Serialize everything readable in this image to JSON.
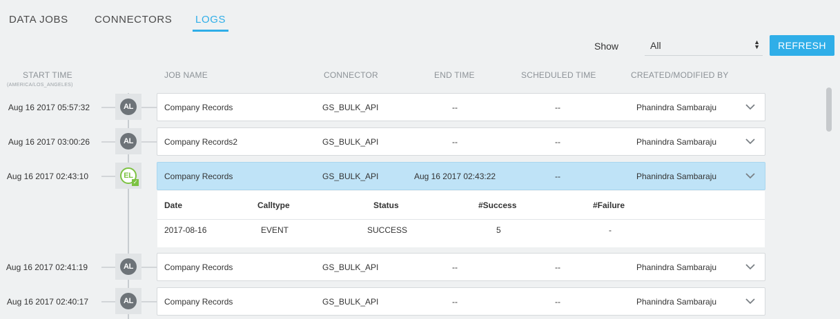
{
  "tabs": [
    {
      "label": "DATA JOBS",
      "active": false
    },
    {
      "label": "CONNECTORS",
      "active": false
    },
    {
      "label": "LOGS",
      "active": true
    }
  ],
  "filter": {
    "show_label": "Show",
    "selected": "All",
    "refresh_label": "REFRESH"
  },
  "columns": {
    "start_time": "START TIME",
    "start_time_tz": "(AMERICA/LOS_ANGELES)",
    "job_name": "JOB NAME",
    "connector": "CONNECTOR",
    "end_time": "END TIME",
    "scheduled_time": "SCHEDULED TIME",
    "created_by": "CREATED/MODIFIED BY"
  },
  "jobs": [
    {
      "start": "Aug 16 2017 05:57:32",
      "badge": "AL",
      "name": "Company Records",
      "connector": "GS_BULK_API",
      "end": "--",
      "scheduled": "--",
      "by": "Phanindra Sambaraju"
    },
    {
      "start": "Aug 16 2017 03:00:26",
      "badge": "AL",
      "name": "Company Records2",
      "connector": "GS_BULK_API",
      "end": "--",
      "scheduled": "--",
      "by": "Phanindra Sambaraju"
    },
    {
      "start": "Aug 16 2017 02:43:10",
      "badge": "EL",
      "name": "Company Records",
      "connector": "GS_BULK_API",
      "end": "Aug 16 2017 02:43:22",
      "scheduled": "--",
      "by": "Phanindra Sambaraju"
    },
    {
      "start": "Aug 16 2017 02:41:19",
      "badge": "AL",
      "name": "Company Records",
      "connector": "GS_BULK_API",
      "end": "--",
      "scheduled": "--",
      "by": "Phanindra Sambaraju"
    },
    {
      "start": "Aug 16 2017 02:40:17",
      "badge": "AL",
      "name": "Company Records",
      "connector": "GS_BULK_API",
      "end": "--",
      "scheduled": "--",
      "by": "Phanindra Sambaraju"
    }
  ],
  "detail": {
    "headers": [
      "Date",
      "Calltype",
      "Status",
      "#Success",
      "#Failure"
    ],
    "row": [
      "2017-08-16",
      "EVENT",
      "SUCCESS",
      "5",
      "-"
    ]
  },
  "colors": {
    "accent": "#2faee8",
    "selected_row": "#bfe3f7",
    "success_badge": "#7cc242",
    "default_badge": "#6d7378"
  },
  "icons": {
    "row_expand": "chevron-down-icon",
    "badge_success": "check-icon"
  }
}
